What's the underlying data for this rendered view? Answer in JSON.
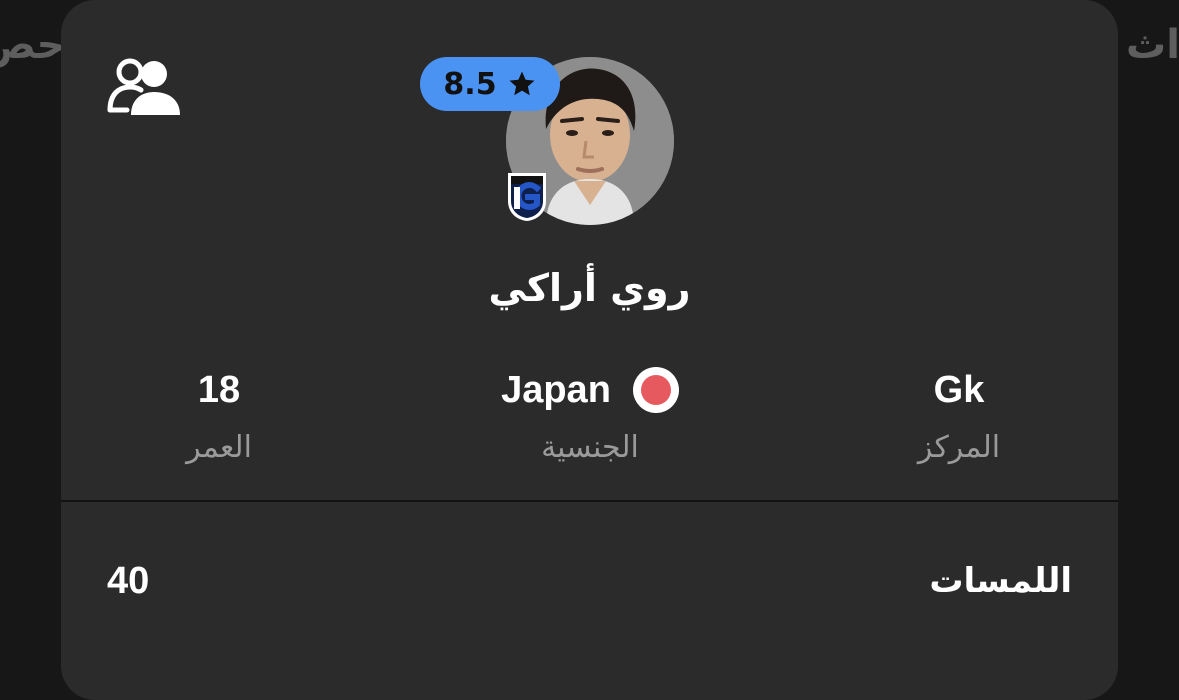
{
  "background": {
    "left_peek_text": "حص",
    "right_peek_text": "اث"
  },
  "card": {
    "player_name": "روي أراكي",
    "rating": "8.5",
    "rating_color": "#4a93f2",
    "icons": {
      "compare": "user-compare-icon",
      "rating": "star-icon",
      "team": "gamba-osaka-badge-icon",
      "nationality_flag": "japan-flag-icon"
    },
    "stats": [
      {
        "label": "المركز",
        "value": "Gk"
      },
      {
        "label": "الجنسية",
        "value": "Japan"
      },
      {
        "label": "العمر",
        "value": "18"
      }
    ],
    "touches": {
      "label": "اللمسات",
      "value": "40"
    }
  }
}
